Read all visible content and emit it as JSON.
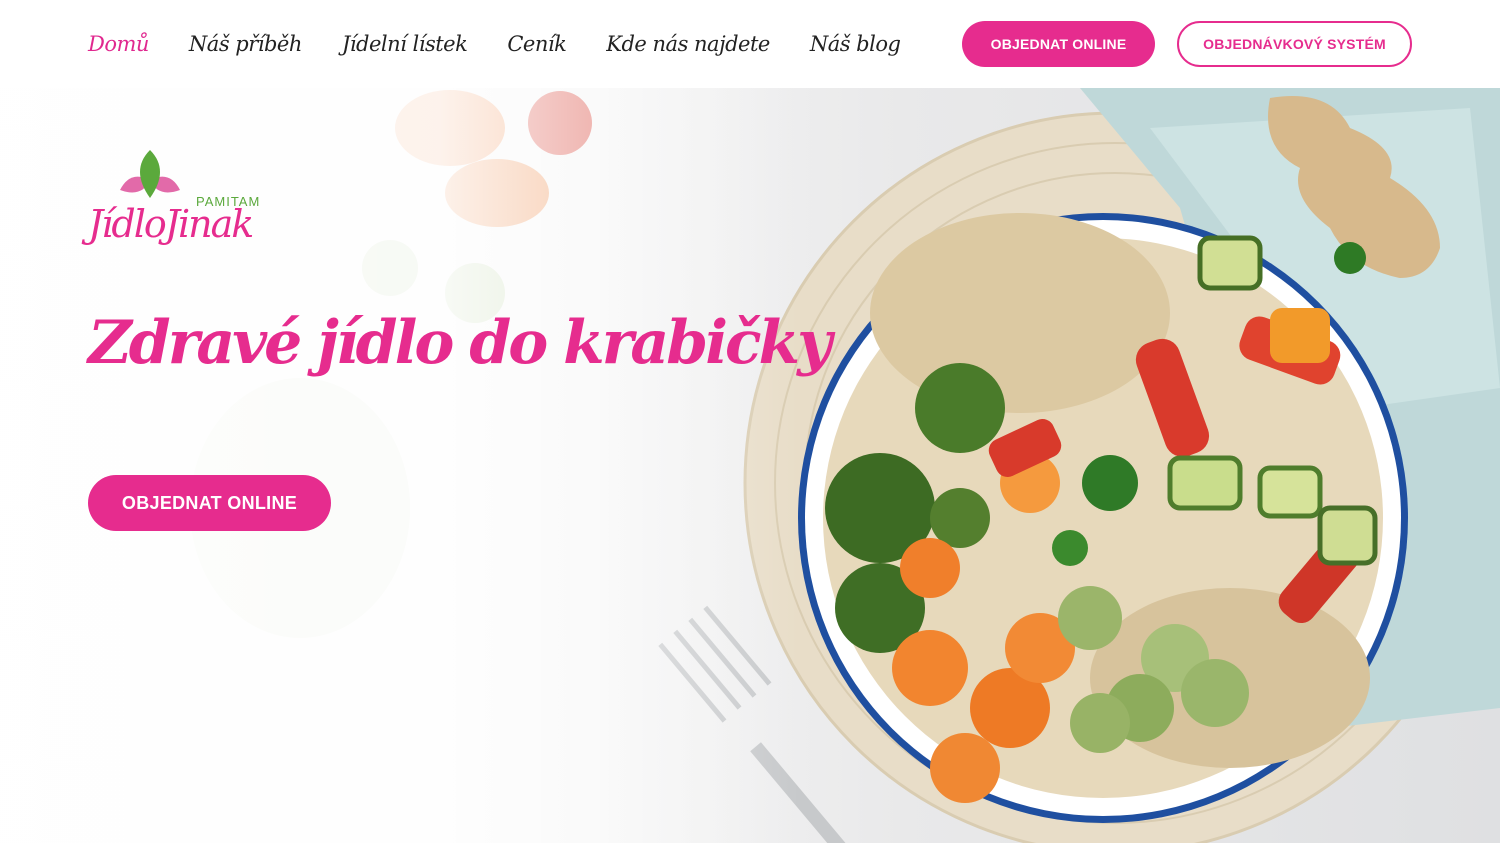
{
  "nav": {
    "items": [
      {
        "label": "Domů",
        "active": true
      },
      {
        "label": "Náš příběh",
        "active": false
      },
      {
        "label": "Jídelní lístek",
        "active": false
      },
      {
        "label": "Ceník",
        "active": false
      },
      {
        "label": "Kde nás najdete",
        "active": false
      },
      {
        "label": "Náš blog",
        "active": false
      }
    ],
    "order_button": "OBJEDNAT ONLINE",
    "system_button": "OBJEDNÁVKOVÝ SYSTÉM"
  },
  "logo": {
    "brand": "JídloJinak",
    "sub": "PAMITAM"
  },
  "hero": {
    "headline": "Zdravé jídlo do krabičky",
    "cta": "OBJEDNAT ONLINE",
    "image": "bowl-of-quinoa-and-roasted-vegetables"
  },
  "colors": {
    "accent": "#e62c8e",
    "leaf": "#5ba93c"
  }
}
